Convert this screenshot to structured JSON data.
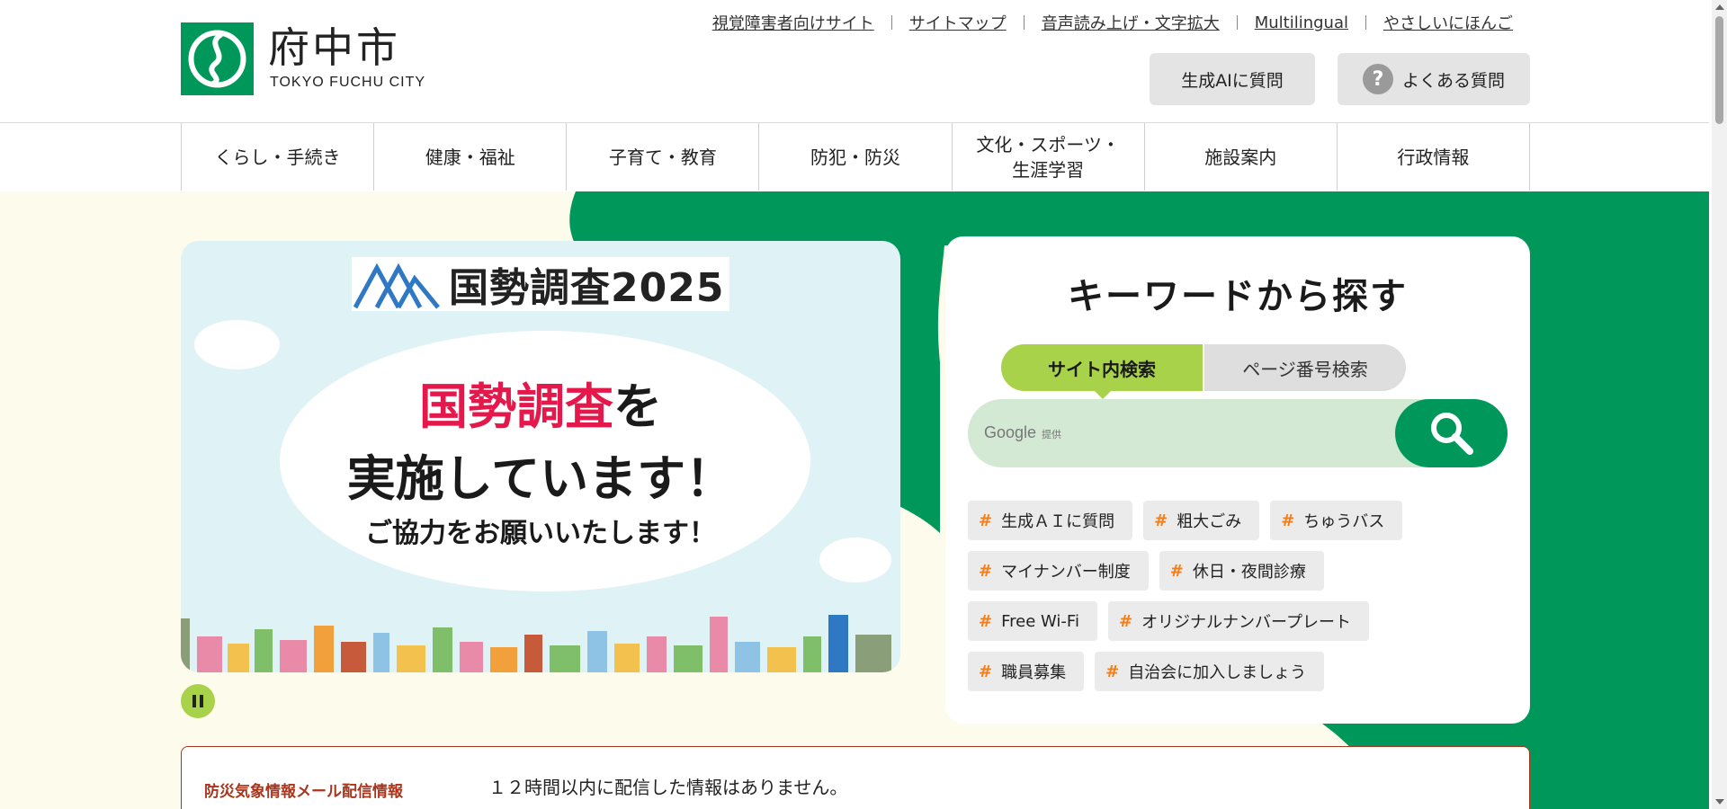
{
  "header": {
    "logo_title": "府中市",
    "logo_subtitle": "TOKYO FUCHU CITY",
    "utility_links": [
      "視覚障害者向けサイト",
      "サイトマップ",
      "音声読み上げ・文字拡大",
      "Multilingual",
      "やさしいにほんご"
    ],
    "ai_button": "生成AIに質問",
    "faq_button": "よくある質問",
    "faq_icon": "?"
  },
  "nav": {
    "items": [
      "くらし・手続き",
      "健康・福祉",
      "子育て・教育",
      "防犯・防災",
      "文化・スポーツ・\n生涯学習",
      "施設案内",
      "行政情報"
    ]
  },
  "hero": {
    "banner_title": "国勢調査2025",
    "line1_red": "国勢調査",
    "line1_rest": "を",
    "line2": "実施しています！",
    "line3": "ご協力をお願いいたします！",
    "pause_icon": "pause-icon"
  },
  "search": {
    "title": "キーワードから探す",
    "tab_site": "サイト内検索",
    "tab_page": "ページ番号検索",
    "placeholder_brand": "Google",
    "placeholder_suffix": "提供",
    "button_icon": "search-icon",
    "tags": [
      [
        "生成ＡＩに質問",
        "粗大ごみ",
        "ちゅうバス"
      ],
      [
        "マイナンバー制度",
        "休日・夜間診療"
      ],
      [
        "Free Wi-Fi",
        "オリジナルナンバープレート"
      ],
      [
        "職員募集",
        "自治会に加入しましょう"
      ]
    ],
    "tag_hash": "#"
  },
  "notice": {
    "label": "防災気象情報メール配信情報",
    "text": "１２時間以内に配信した情報はありません。"
  },
  "colors": {
    "brand_green": "#00985a",
    "accent_lime": "#a8d24a",
    "tag_hash": "#f07f1b",
    "notice_red": "#a8361e",
    "hero_red": "#e5184b"
  }
}
